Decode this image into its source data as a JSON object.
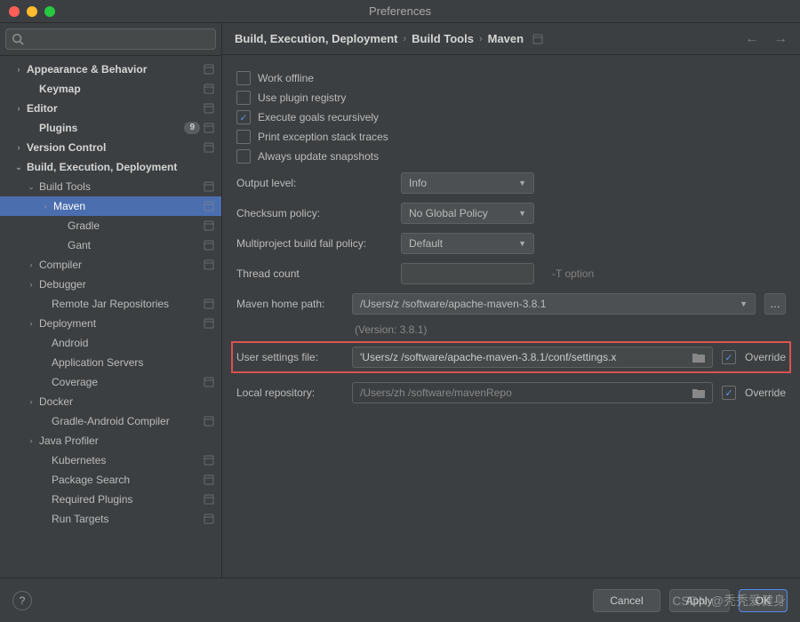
{
  "window": {
    "title": "Preferences"
  },
  "search": {
    "placeholder": ""
  },
  "sidebar": {
    "items": [
      {
        "label": "Appearance & Behavior",
        "bold": true,
        "chev": "›",
        "indent": 14,
        "sep": true
      },
      {
        "label": "Keymap",
        "bold": true,
        "chev": "",
        "indent": 28,
        "sep": true
      },
      {
        "label": "Editor",
        "bold": true,
        "chev": "›",
        "indent": 14,
        "sep": true
      },
      {
        "label": "Plugins",
        "bold": true,
        "chev": "",
        "indent": 28,
        "badge": "9",
        "sep": true
      },
      {
        "label": "Version Control",
        "bold": true,
        "chev": "›",
        "indent": 14,
        "sep": true
      },
      {
        "label": "Build, Execution, Deployment",
        "bold": true,
        "chev": "⌄",
        "indent": 14
      },
      {
        "label": "Build Tools",
        "chev": "⌄",
        "indent": 28,
        "sep": true
      },
      {
        "label": "Maven",
        "chev": "›",
        "indent": 44,
        "selected": true,
        "sep": true
      },
      {
        "label": "Gradle",
        "chev": "",
        "indent": 60,
        "sep": true
      },
      {
        "label": "Gant",
        "chev": "",
        "indent": 60,
        "sep": true
      },
      {
        "label": "Compiler",
        "chev": "›",
        "indent": 28,
        "sep": true
      },
      {
        "label": "Debugger",
        "chev": "›",
        "indent": 28
      },
      {
        "label": "Remote Jar Repositories",
        "chev": "",
        "indent": 42,
        "sep": true
      },
      {
        "label": "Deployment",
        "chev": "›",
        "indent": 28,
        "sep": true
      },
      {
        "label": "Android",
        "chev": "",
        "indent": 42
      },
      {
        "label": "Application Servers",
        "chev": "",
        "indent": 42
      },
      {
        "label": "Coverage",
        "chev": "",
        "indent": 42,
        "sep": true
      },
      {
        "label": "Docker",
        "chev": "›",
        "indent": 28
      },
      {
        "label": "Gradle-Android Compiler",
        "chev": "",
        "indent": 42,
        "sep": true
      },
      {
        "label": "Java Profiler",
        "chev": "›",
        "indent": 28
      },
      {
        "label": "Kubernetes",
        "chev": "",
        "indent": 42,
        "sep": true
      },
      {
        "label": "Package Search",
        "chev": "",
        "indent": 42,
        "sep": true
      },
      {
        "label": "Required Plugins",
        "chev": "",
        "indent": 42,
        "sep": true
      },
      {
        "label": "Run Targets",
        "chev": "",
        "indent": 42,
        "sep": true
      }
    ]
  },
  "breadcrumb": {
    "a": "Build, Execution, Deployment",
    "b": "Build Tools",
    "c": "Maven"
  },
  "checks": {
    "offline": "Work offline",
    "plugin_registry": "Use plugin registry",
    "goals_recursive": "Execute goals recursively",
    "stack_traces": "Print exception stack traces",
    "snapshots": "Always update snapshots"
  },
  "fields": {
    "output_level": {
      "label": "Output level:",
      "value": "Info"
    },
    "checksum": {
      "label": "Checksum policy:",
      "value": "No Global Policy"
    },
    "fail_policy": {
      "label": "Multiproject build fail policy:",
      "value": "Default"
    },
    "thread_count": {
      "label": "Thread count",
      "value": "",
      "hint": "-T option"
    },
    "home_path": {
      "label": "Maven home path:",
      "value": "/Users/z         /software/apache-maven-3.8.1"
    },
    "version": "(Version: 3.8.1)",
    "settings_file": {
      "label": "User settings file:",
      "value": "'Users/z           /software/apache-maven-3.8.1/conf/settings.x",
      "override": "Override"
    },
    "local_repo": {
      "label": "Local repository:",
      "value": "/Users/zh       /software/mavenRepo",
      "override": "Override"
    }
  },
  "footer": {
    "cancel": "Cancel",
    "apply": "Apply",
    "ok": "OK"
  },
  "watermark": "CSDN @秃秃爱健身"
}
